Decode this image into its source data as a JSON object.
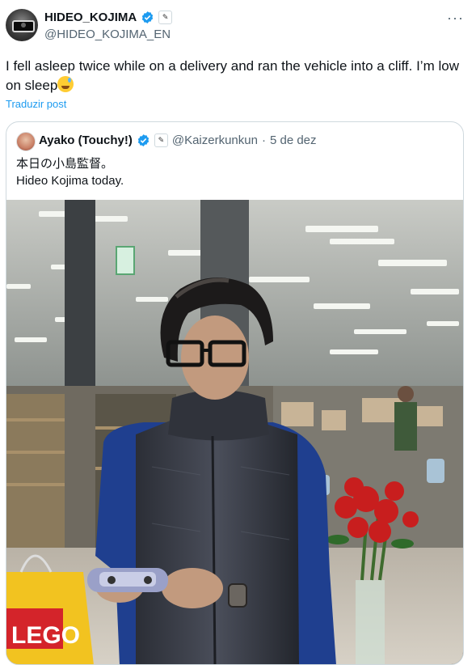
{
  "post": {
    "author": {
      "display_name": "HIDEO_KOJIMA",
      "handle": "@HIDEO_KOJIMA_EN",
      "verified": true
    },
    "more_label": "···",
    "text": "I fell asleep twice while on a delivery and ran the vehicle into a cliff. I’m low on sleep",
    "translate_label": "Traduzir post"
  },
  "quote": {
    "author": {
      "display_name": "Ayako (Touchy!)",
      "handle": "@Kaizerkunkun",
      "separator": "·",
      "date": "5 de dez",
      "verified": true
    },
    "text_line1": "本日の小島監督。",
    "text_line2": "Hideo Kojima today.",
    "photo": {
      "bag_text": "LEGO"
    }
  },
  "colors": {
    "verified_blue": "#1d9bf0",
    "link_blue": "#1d9bf0",
    "muted_text": "#536471",
    "border": "#cfd9de"
  }
}
